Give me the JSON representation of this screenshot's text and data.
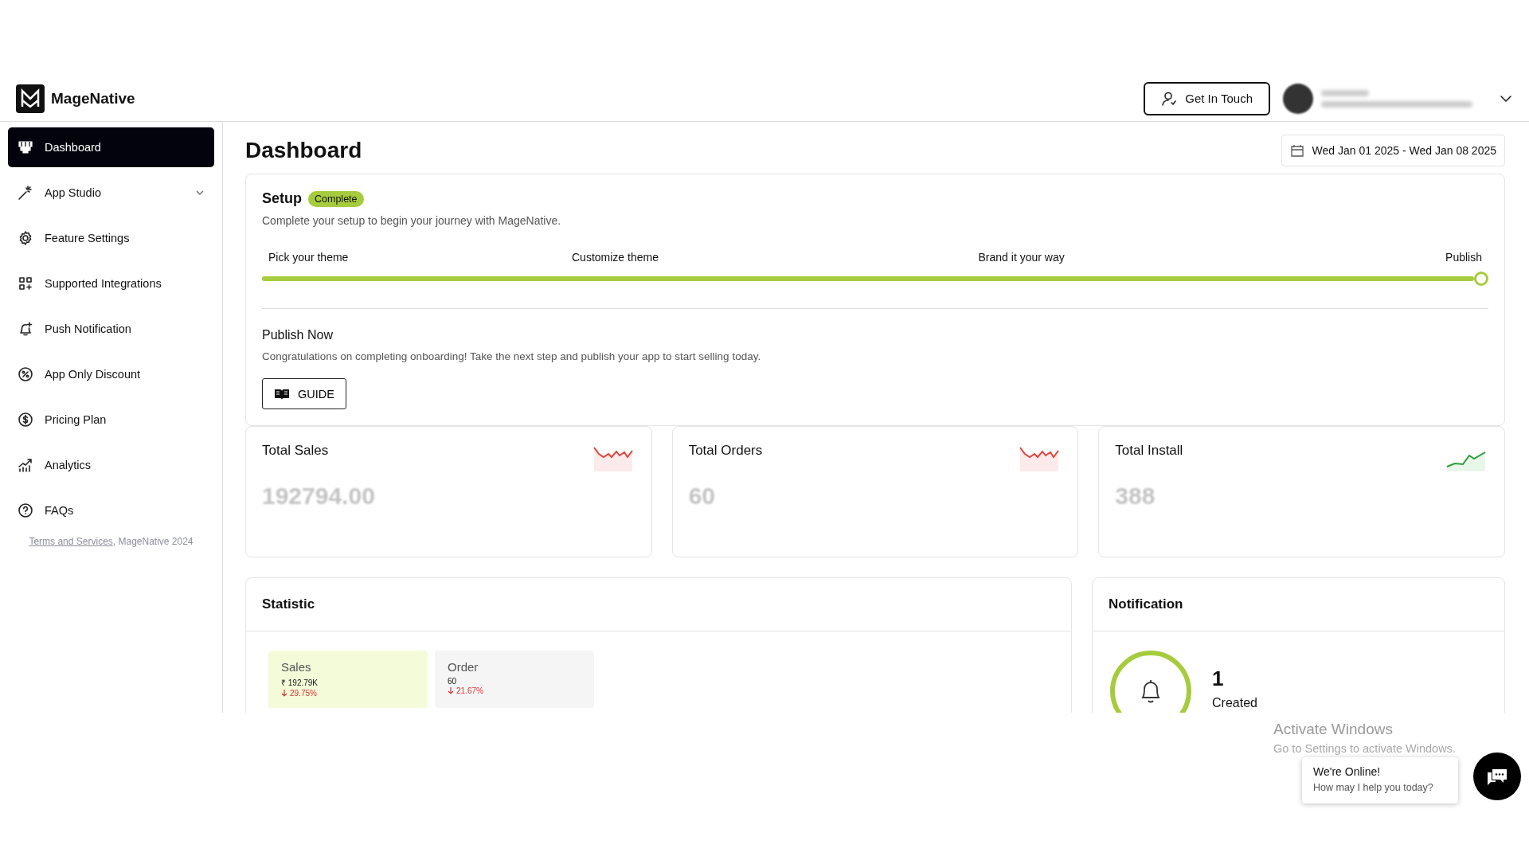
{
  "brand": {
    "name": "MageNative"
  },
  "header": {
    "contact_button": "Get In Touch"
  },
  "sidebar": {
    "items": [
      {
        "label": "Dashboard",
        "selected": true,
        "expandable": false
      },
      {
        "label": "App Studio",
        "selected": false,
        "expandable": true
      },
      {
        "label": "Feature Settings",
        "selected": false,
        "expandable": false
      },
      {
        "label": "Supported Integrations",
        "selected": false,
        "expandable": false
      },
      {
        "label": "Push Notification",
        "selected": false,
        "expandable": false
      },
      {
        "label": "App Only Discount",
        "selected": false,
        "expandable": false
      },
      {
        "label": "Pricing Plan",
        "selected": false,
        "expandable": false
      },
      {
        "label": "Analytics",
        "selected": false,
        "expandable": false
      },
      {
        "label": "FAQs",
        "selected": false,
        "expandable": false
      }
    ],
    "footer": {
      "link": "Terms and Services",
      "text": ", MageNative 2024"
    }
  },
  "page": {
    "title": "Dashboard",
    "date_range": "Wed Jan 01 2025 - Wed Jan 08 2025"
  },
  "setup": {
    "title": "Setup",
    "badge": "Complete",
    "description": "Complete your setup to begin your journey with MageNative.",
    "steps": [
      "Pick your theme",
      "Customize theme",
      "Brand it your way",
      "Publish"
    ],
    "level": 1,
    "next": {
      "title": "Publish Now",
      "text": "Congratulations on completing onboarding! Take the next step and publish your app to start selling today.",
      "button": "GUIDE"
    }
  },
  "stats": [
    {
      "title": "Total Sales",
      "value": "192794.00",
      "kind": "down"
    },
    {
      "title": "Total Orders",
      "value": "60",
      "kind": "down"
    },
    {
      "title": "Total Install",
      "value": "388",
      "kind": "up"
    }
  ],
  "statistic": {
    "title": "Statistic",
    "tabs": [
      {
        "label": "Sales",
        "value": "₹ 192.79K",
        "change": "29.75%",
        "selected": true
      },
      {
        "label": "Order",
        "value": "60",
        "change": "21.67%",
        "selected": false
      }
    ]
  },
  "notification": {
    "title": "Notification",
    "count": "1",
    "label": "Created"
  },
  "os_notice": {
    "title": "Activate Windows",
    "text": "Go to Settings to activate Windows."
  },
  "chat": {
    "title": "We're Online!",
    "subtitle": "How may I help you today?"
  }
}
